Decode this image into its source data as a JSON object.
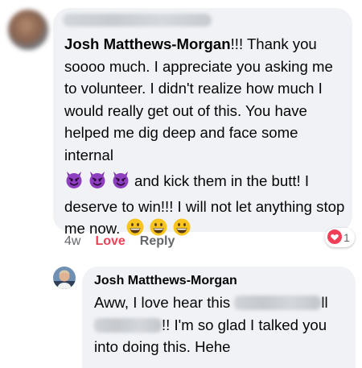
{
  "comment": {
    "author": "Josh Matthews-Morgan",
    "after_author": "!!! Thank you soooo much. I appreciate you asking me to volunteer. I didn't realize how much I would really get out of this. You have helped me dig deep and face some internal",
    "after_emojis": "and kick them in the butt! I deserve to win!!! I will not let anything stop me now.",
    "emoji_devil": "smiling-face-with-horns",
    "emoji_grin": "grinning-face",
    "time": "4w",
    "love_label": "Love",
    "reply_label": "Reply",
    "reaction_count": "1",
    "reaction_icon": "heart-icon"
  },
  "reply": {
    "author": "Josh Matthews-Morgan",
    "text_start": "Aww, I love hear this",
    "text_part2": "ll",
    "text_end": "!! I'm so glad I talked you into doing this. Hehe"
  },
  "colors": {
    "bubble": "#f0f2f5",
    "love_red": "#f33e58",
    "secondary_text": "#65676b",
    "text": "#050505"
  }
}
